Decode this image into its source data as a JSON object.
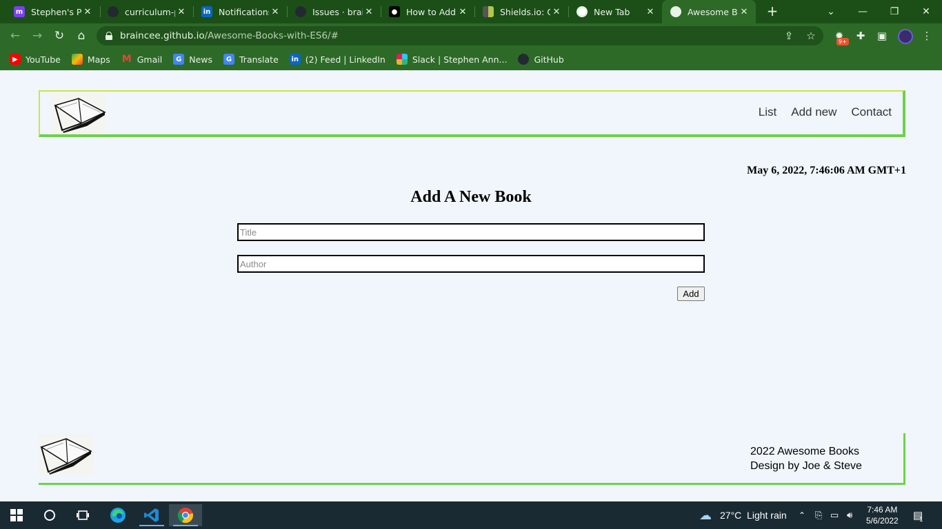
{
  "browser": {
    "tabs": [
      {
        "label": "Stephen's Pro",
        "icon": "polywork-icon",
        "color": "#7b3ff2"
      },
      {
        "label": "curriculum-pr",
        "icon": "github-icon",
        "color": "#24292f"
      },
      {
        "label": "Notifications",
        "icon": "linkedin-icon",
        "color": "#0a66c2"
      },
      {
        "label": "Issues · brainc",
        "icon": "github-icon",
        "color": "#24292f"
      },
      {
        "label": "How to Add B",
        "icon": "medium-icon",
        "color": "#000000"
      },
      {
        "label": "Shields.io: Qu",
        "icon": "shields-icon",
        "color": "#b5c44a"
      },
      {
        "label": "New Tab",
        "icon": "chrome-icon",
        "color": "#ffffff"
      },
      {
        "label": "Awesome Boo",
        "icon": "globe-icon",
        "color": "#ffffff"
      }
    ],
    "url_host": "braincee.github.io",
    "url_path": "/Awesome-Books-with-ES6/#",
    "extension_badge": "9+",
    "bookmarks": [
      {
        "label": "YouTube",
        "icon": "youtube-icon",
        "color": "#ff0000"
      },
      {
        "label": "Maps",
        "icon": "maps-icon",
        "color": "#34a853"
      },
      {
        "label": "Gmail",
        "icon": "gmail-icon",
        "color": "#ea4335"
      },
      {
        "label": "News",
        "icon": "news-icon",
        "color": "#4285f4"
      },
      {
        "label": "Translate",
        "icon": "translate-icon",
        "color": "#4285f4"
      },
      {
        "label": "(2) Feed | LinkedIn",
        "icon": "linkedin-icon",
        "color": "#0a66c2"
      },
      {
        "label": "Slack | Stephen Ann...",
        "icon": "slack-icon",
        "color": "#e01e5a"
      },
      {
        "label": "GitHub",
        "icon": "github-icon",
        "color": "#24292f"
      }
    ]
  },
  "page": {
    "nav": {
      "list": "List",
      "add_new": "Add new",
      "contact": "Contact"
    },
    "datetime": "May 6, 2022, 7:46:06 AM GMT+1",
    "form": {
      "title": "Add A New Book",
      "title_placeholder": "Title",
      "author_placeholder": "Author",
      "add_label": "Add"
    },
    "footer": {
      "line1": "2022 Awesome Books",
      "line2": "Design by Joe & Steve"
    }
  },
  "taskbar": {
    "weather": "27°C  Light rain",
    "time": "7:46 AM",
    "date": "5/6/2022",
    "notification_count": "1"
  }
}
